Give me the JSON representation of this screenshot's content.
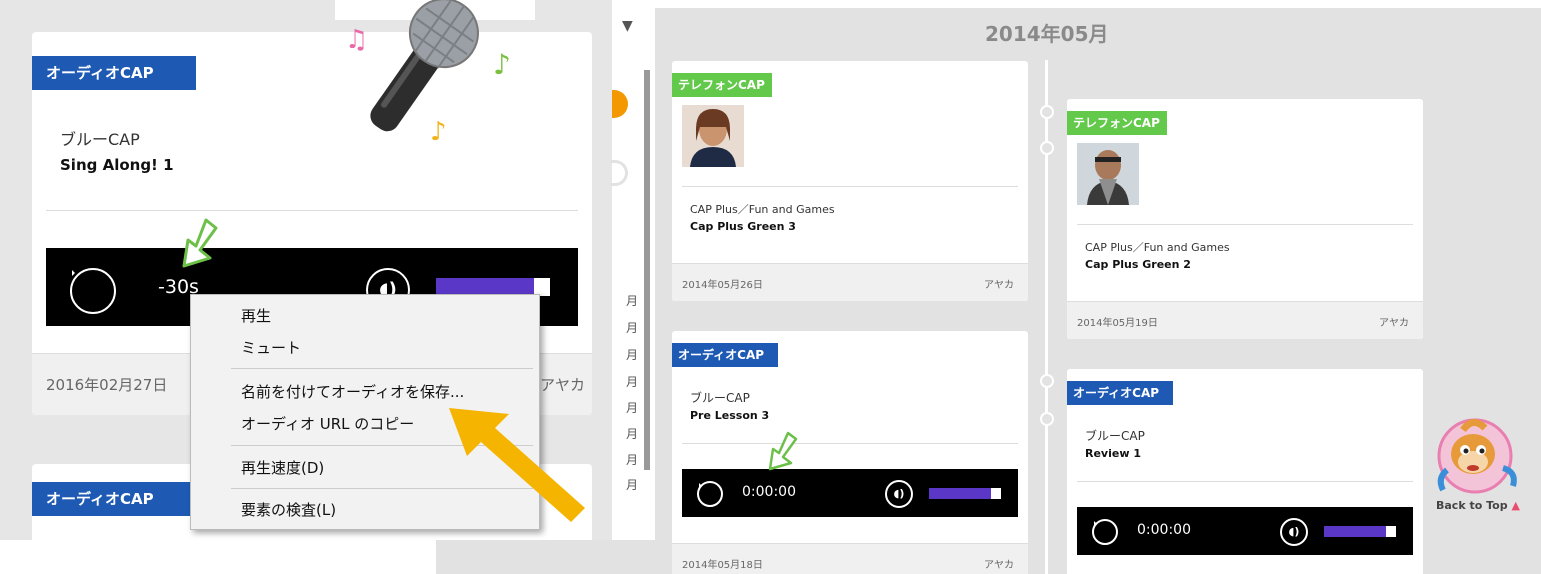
{
  "left_card": {
    "badge": "オーディオCAP",
    "category": "ブルーCAP",
    "title": "Sing Along! 1",
    "player_time": "-30s",
    "date": "2016年02月27日",
    "author": "アヤカ"
  },
  "left_card2": {
    "badge": "オーディオCAP"
  },
  "context_menu": {
    "items": [
      "再生",
      "ミュート",
      "名前を付けてオーディオを保存...",
      "オーディオ URL のコピー",
      "再生速度(D)",
      "要素の検査(L)"
    ]
  },
  "strip": {
    "dropdown_glyph": "▼",
    "month_glyphs": [
      "月",
      "月",
      "月",
      "月",
      "月",
      "月",
      "月",
      "月"
    ]
  },
  "timeline": {
    "month_heading": "2014年05月",
    "cards": [
      {
        "badge": "テレフォンCAP",
        "category": "CAP Plus／Fun and Games",
        "title": "Cap Plus Green 3",
        "date": "2014年05月26日",
        "author": "アヤカ"
      },
      {
        "badge": "テレフォンCAP",
        "category": "CAP Plus／Fun and Games",
        "title": "Cap Plus Green 2",
        "date": "2014年05月19日",
        "author": "アヤカ"
      },
      {
        "badge": "オーディオCAP",
        "category": "ブルーCAP",
        "title": "Pre Lesson 3",
        "player_time": "0:00:00",
        "date": "2014年05月18日",
        "author": "アヤカ"
      },
      {
        "badge": "オーディオCAP",
        "category": "ブルーCAP",
        "title": "Review 1",
        "player_time": "0:00:00"
      }
    ]
  },
  "back_to_top": {
    "label": "Back to Top",
    "arrow": "▲"
  },
  "colors": {
    "audio_badge": "#1e5ab4",
    "phone_badge": "#62c94a",
    "volume": "#5b37c8",
    "highlight_arrow": "#f5b400",
    "timeline_bg": "#e2e2e2"
  }
}
